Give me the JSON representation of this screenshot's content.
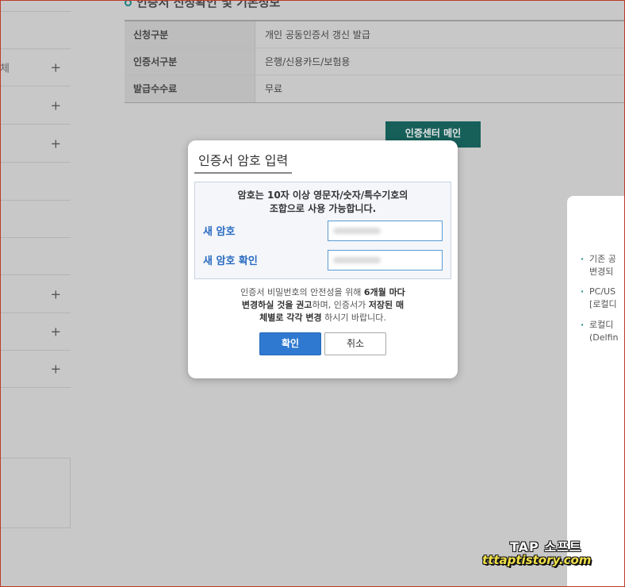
{
  "section": {
    "title": "인증서 신청확인 및 기본정보"
  },
  "info_table": [
    {
      "label": "신청구분",
      "value": "개인 공동인증서 갱신 발급"
    },
    {
      "label": "인증서구분",
      "value": "은행/신용카드/보험용"
    },
    {
      "label": "발급수수료",
      "value": "무료"
    }
  ],
  "center_button": {
    "label": "인증센터 메인"
  },
  "sidebar": {
    "fragment": "체",
    "plus": "+"
  },
  "right_panel": {
    "items": [
      {
        "line1": "기존 공",
        "line2": "변경되"
      },
      {
        "line1": "PC/US",
        "line2": "[로컬디"
      },
      {
        "line1": "로컬디",
        "line2": "(Delfin"
      }
    ],
    "bullet": "·"
  },
  "modal": {
    "title": "인증서 암호 입력",
    "notice_line1": "암호는 10자 이상 영문자/숫자/특수기호의",
    "notice_line2": "조합으로 사용 가능합니다.",
    "new_pw_label": "새 암호",
    "confirm_pw_label": "새 암호 확인",
    "advice": {
      "p1": "인증서 비밀번호의 안전성을 위해 ",
      "b1": "6개월 마다",
      "b2": "변경하실 것을 권고",
      "p2": "하며, 인증서가 ",
      "b3": "저장된 매",
      "b4": "체별로 각각 변경",
      "p3": " 하시기 바랍니다."
    },
    "ok_label": "확인",
    "cancel_label": "취소"
  },
  "watermark": {
    "line1": "TAP 소프트",
    "line2": "tttaptistory.com"
  },
  "colors": {
    "accent": "#2f79d1",
    "teal": "#17605a",
    "label_blue": "#2a6bc0"
  }
}
